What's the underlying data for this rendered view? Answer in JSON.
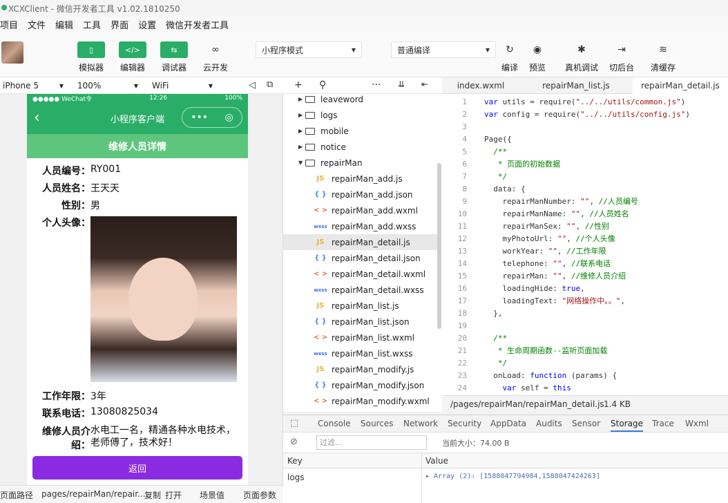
{
  "window": {
    "title": "XCXClient - 微信开发者工具 v1.02.1810250"
  },
  "menu": [
    "项目",
    "文件",
    "编辑",
    "工具",
    "界面",
    "设置",
    "微信开发者工具"
  ],
  "toolbar": {
    "left_buttons": [
      {
        "label": "模拟器",
        "icon": "phone-icon",
        "glyph": "▯"
      },
      {
        "label": "编辑器",
        "icon": "code-icon",
        "glyph": "</>"
      },
      {
        "label": "调试器",
        "icon": "debug-icon",
        "glyph": "⇆"
      },
      {
        "label": "云开发",
        "icon": "cloud-icon",
        "glyph": "∞"
      }
    ],
    "mode_select": "小程序模式",
    "compile_select": "普通编译",
    "right_buttons": [
      {
        "label": "编译",
        "icon": "refresh-icon",
        "glyph": "↻"
      },
      {
        "label": "预览",
        "icon": "eye-icon",
        "glyph": "◉"
      },
      {
        "label": "真机调试",
        "icon": "bug-icon",
        "glyph": "✱"
      },
      {
        "label": "切后台",
        "icon": "switch-icon",
        "glyph": "⇥"
      },
      {
        "label": "清缓存",
        "icon": "layers-icon",
        "glyph": "≋"
      }
    ]
  },
  "device_bar": {
    "device": "iPhone 5",
    "zoom": "100%",
    "network": "WiFi"
  },
  "phone": {
    "status_left": "●●●●● WeChat令",
    "status_time": "12:26",
    "status_right": "100%",
    "nav_title": "小程序客户端",
    "capsule_more": "•••",
    "capsule_close": "◎",
    "header": "维修人员详情",
    "fields": [
      {
        "key": "人员编号：",
        "value": "RY001"
      },
      {
        "key": "人员姓名：",
        "value": "王天天"
      },
      {
        "key": "性别：",
        "value": "男"
      },
      {
        "key": "个人头像：",
        "value": ""
      },
      {
        "key": "工作年限：",
        "value": "3年"
      },
      {
        "key": "联系电话：",
        "value": "13080825034"
      },
      {
        "key": "维修人员介绍：",
        "value": "水电工一名，精通各种水电技术，老师傅了，技术好！"
      }
    ],
    "back_button": "返回"
  },
  "bottom_bar": {
    "path_label": "页面路径",
    "path": "pages/repairMan/repair...",
    "copy": "复制",
    "open": "打开",
    "scene": "场景值",
    "params": "页面参数"
  },
  "tree": [
    {
      "type": "folder",
      "name": "leaveword",
      "expanded": false
    },
    {
      "type": "folder",
      "name": "logs",
      "expanded": false
    },
    {
      "type": "folder",
      "name": "mobile",
      "expanded": false
    },
    {
      "type": "folder",
      "name": "notice",
      "expanded": false
    },
    {
      "type": "folder",
      "name": "repairMan",
      "expanded": true
    },
    {
      "type": "js",
      "name": "repairMan_add.js"
    },
    {
      "type": "json",
      "name": "repairMan_add.json"
    },
    {
      "type": "wxml",
      "name": "repairMan_add.wxml"
    },
    {
      "type": "wxss",
      "name": "repairMan_add.wxss"
    },
    {
      "type": "js",
      "name": "repairMan_detail.js",
      "selected": true
    },
    {
      "type": "json",
      "name": "repairMan_detail.json"
    },
    {
      "type": "wxml",
      "name": "repairMan_detail.wxml"
    },
    {
      "type": "wxss",
      "name": "repairMan_detail.wxss"
    },
    {
      "type": "js",
      "name": "repairMan_list.js"
    },
    {
      "type": "json",
      "name": "repairMan_list.json"
    },
    {
      "type": "wxml",
      "name": "repairMan_list.wxml"
    },
    {
      "type": "wxss",
      "name": "repairMan_list.wxss"
    },
    {
      "type": "js",
      "name": "repairMan_modify.js"
    },
    {
      "type": "json",
      "name": "repairMan_modify.json"
    },
    {
      "type": "wxml",
      "name": "repairMan_modify.wxml"
    }
  ],
  "file_icons": {
    "js": "JS",
    "json": "{ }",
    "wxml": "< >",
    "wxss": "wxss"
  },
  "file_icon_colors": {
    "js": "#e8b13a",
    "json": "#3a8ee6",
    "wxml": "#e06a3a",
    "wxss": "#3a6ee6"
  },
  "tabs": [
    "index.wxml",
    "repairMan_list.js",
    "repairMan_detail.js"
  ],
  "active_tab": 2,
  "code": [
    {
      "n": "1",
      "t": "var utils = require(\"../../utils/common.js\")"
    },
    {
      "n": "2",
      "t": "var config = require(\"../../utils/config.js\")"
    },
    {
      "n": "3",
      "t": ""
    },
    {
      "n": "4",
      "t": "Page({"
    },
    {
      "n": "5",
      "t": "  /**"
    },
    {
      "n": "6",
      "t": "   * 页面的初始数据"
    },
    {
      "n": "7",
      "t": "   */"
    },
    {
      "n": "8",
      "t": "  data: {"
    },
    {
      "n": "9",
      "t": "    repairManNumber: \"\", //人员编号"
    },
    {
      "n": "10",
      "t": "    repairManName: \"\", //人员姓名"
    },
    {
      "n": "11",
      "t": "    repairManSex: \"\", //性别"
    },
    {
      "n": "12",
      "t": "    myPhotoUrl: \"\", //个人头像"
    },
    {
      "n": "13",
      "t": "    workYear: \"\", //工作年限"
    },
    {
      "n": "14",
      "t": "    telephone: \"\", //联系电话"
    },
    {
      "n": "15",
      "t": "    repairMan: \"\", //维修人员介绍"
    },
    {
      "n": "16",
      "t": "    loadingHide: true,"
    },
    {
      "n": "17",
      "t": "    loadingText: \"网络操作中。。\","
    },
    {
      "n": "18",
      "t": "  },"
    },
    {
      "n": "19",
      "t": ""
    },
    {
      "n": "20",
      "t": "  /**"
    },
    {
      "n": "21",
      "t": "   * 生命周期函数--监听页面加载"
    },
    {
      "n": "22",
      "t": "   */"
    },
    {
      "n": "23",
      "t": "  onLoad: function (params) {"
    },
    {
      "n": "24",
      "t": "    var self = this"
    }
  ],
  "editor_status": {
    "path": "/pages/repairMan/repairMan_detail.js",
    "size": "1.4 KB"
  },
  "devtools": {
    "tabs": [
      "Console",
      "Sources",
      "Network",
      "Security",
      "AppData",
      "Audits",
      "Sensor",
      "Storage",
      "Trace",
      "Wxml"
    ],
    "active": "Storage",
    "filter_placeholder": "过滤...",
    "current_size": "当前大小：74.00 B",
    "col_key": "Key",
    "col_value": "Value",
    "row_key": "logs",
    "row_value": "▸ Array (2): [1588047794984,1588047424263]"
  }
}
